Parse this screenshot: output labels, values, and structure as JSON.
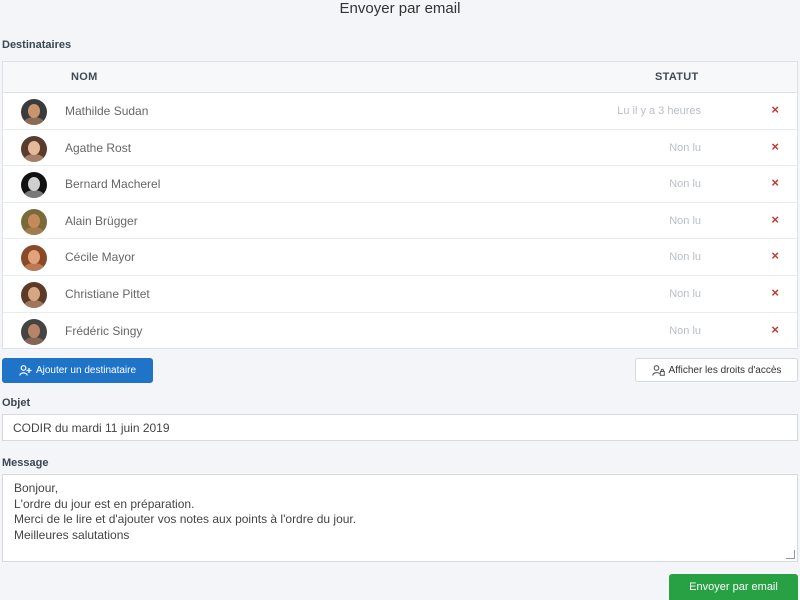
{
  "dialog": {
    "title": "Envoyer par email"
  },
  "recipients": {
    "label": "Destinataires",
    "columns": {
      "name": "NOM",
      "status": "STATUT"
    },
    "rows": [
      {
        "name": "Mathilde Sudan",
        "status": "Lu il y a 3 heures",
        "avatar": {
          "bg": "#3b3b3b",
          "skin": "#c9956e"
        }
      },
      {
        "name": "Agathe Rost",
        "status": "Non lu",
        "avatar": {
          "bg": "#5a3c2e",
          "skin": "#e6b99a"
        }
      },
      {
        "name": "Bernard Macherel",
        "status": "Non lu",
        "avatar": {
          "bg": "#111111",
          "skin": "#cfcfcf"
        }
      },
      {
        "name": "Alain Brügger",
        "status": "Non lu",
        "avatar": {
          "bg": "#7a6a3a",
          "skin": "#c58a5c"
        }
      },
      {
        "name": "Cécile Mayor",
        "status": "Non lu",
        "avatar": {
          "bg": "#8a4a28",
          "skin": "#e1a27d"
        }
      },
      {
        "name": "Christiane Pittet",
        "status": "Non lu",
        "avatar": {
          "bg": "#5b3a28",
          "skin": "#d8a582"
        }
      },
      {
        "name": "Frédéric Singy",
        "status": "Non lu",
        "avatar": {
          "bg": "#444444",
          "skin": "#b88466"
        }
      }
    ],
    "remove_icon": "×"
  },
  "actions": {
    "add_recipient": "Ajouter un destinataire",
    "show_access_rights": "Afficher les droits d'accès"
  },
  "subject": {
    "label": "Objet",
    "value": "CODIR du mardi 11 juin 2019"
  },
  "message": {
    "label": "Message",
    "lines": [
      "Bonjour,",
      "L'ordre du jour est en préparation.",
      "Merci de le lire et d'ajouter vos notes aux points à l'ordre du jour.",
      "Meilleures salutations"
    ]
  },
  "send_button": "Envoyer par email",
  "colors": {
    "primary": "#1f74c8",
    "success": "#27a143",
    "danger": "#c0392b"
  }
}
